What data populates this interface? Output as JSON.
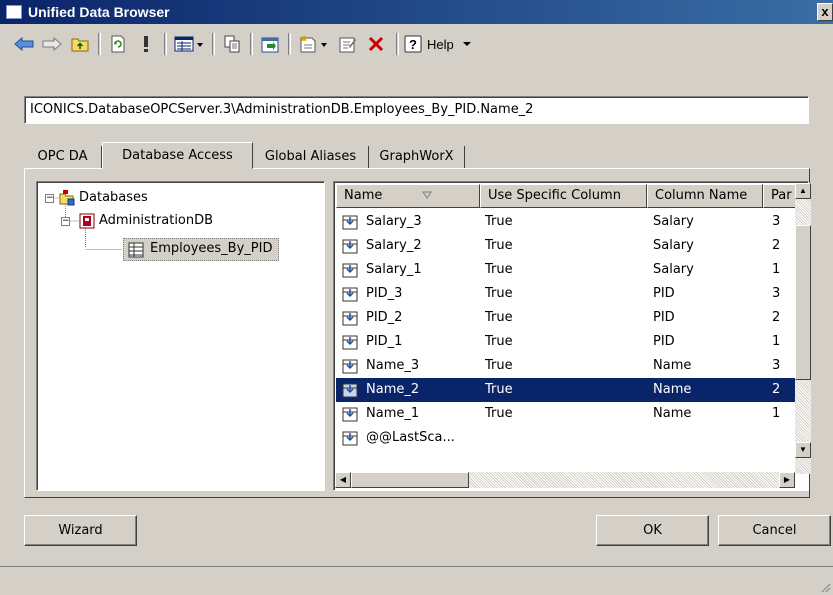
{
  "window": {
    "title": "Unified Data Browser",
    "close_label": "x"
  },
  "toolbar": {
    "help_label": "Help"
  },
  "address": {
    "value": "ICONICS.DatabaseOPCServer.3\\AdministrationDB.Employees_By_PID.Name_2"
  },
  "tabs": [
    {
      "label": "OPC DA",
      "active": false
    },
    {
      "label": "Database Access",
      "active": true
    },
    {
      "label": "Global Aliases",
      "active": false
    },
    {
      "label": "GraphWorX",
      "active": false
    }
  ],
  "tree": {
    "root": "Databases",
    "db": "AdministrationDB",
    "table": "Employees_By_PID"
  },
  "columns": [
    "Name",
    "Use Specific Column",
    "Column Name",
    "Par"
  ],
  "rows": [
    {
      "name": "Salary_3",
      "use": "True",
      "column": "Salary",
      "par": "3"
    },
    {
      "name": "Salary_2",
      "use": "True",
      "column": "Salary",
      "par": "2"
    },
    {
      "name": "Salary_1",
      "use": "True",
      "column": "Salary",
      "par": "1"
    },
    {
      "name": "PID_3",
      "use": "True",
      "column": "PID",
      "par": "3"
    },
    {
      "name": "PID_2",
      "use": "True",
      "column": "PID",
      "par": "2"
    },
    {
      "name": "PID_1",
      "use": "True",
      "column": "PID",
      "par": "1"
    },
    {
      "name": "Name_3",
      "use": "True",
      "column": "Name",
      "par": "3"
    },
    {
      "name": "Name_2",
      "use": "True",
      "column": "Name",
      "par": "2",
      "selected": true
    },
    {
      "name": "Name_1",
      "use": "True",
      "column": "Name",
      "par": "1"
    },
    {
      "name": "@@LastSca...",
      "use": "",
      "column": "",
      "par": ""
    }
  ],
  "buttons": {
    "wizard": "Wizard",
    "ok": "OK",
    "cancel": "Cancel"
  },
  "colors": {
    "title_bar": "#0a246a",
    "selection": "#0a246a",
    "face": "#d4d0c8",
    "delete_icon": "#cc0000"
  }
}
